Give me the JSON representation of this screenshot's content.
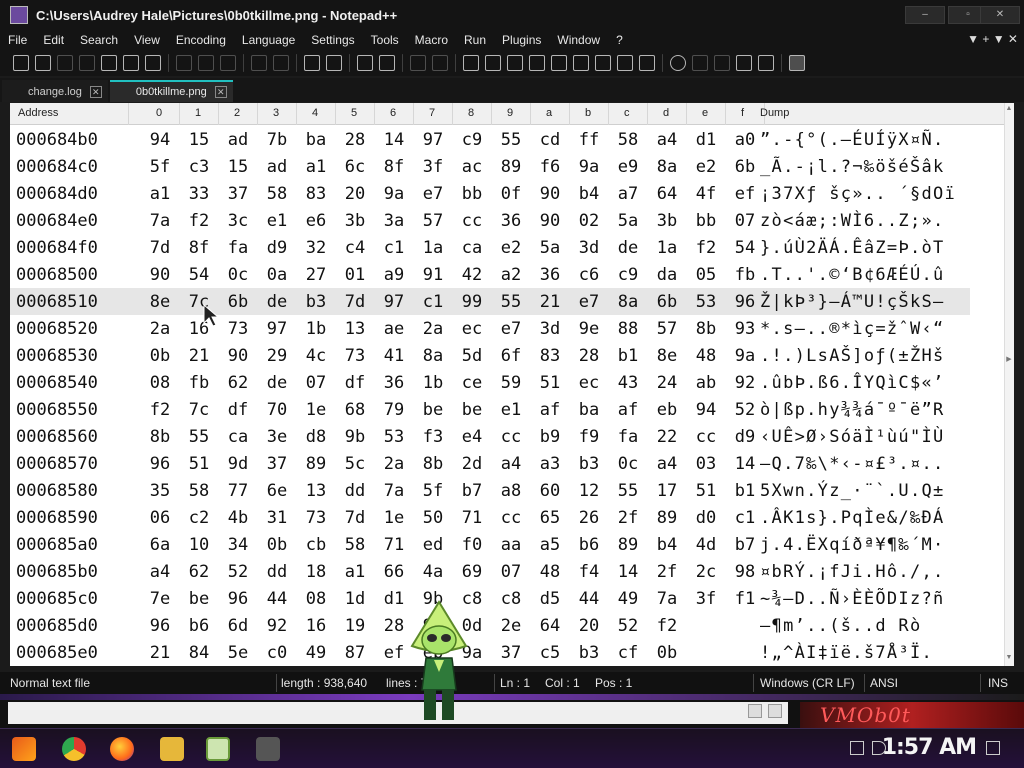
{
  "window": {
    "title": "C:\\Users\\Audrey Hale\\Pictures\\0b0tkillme.png - Notepad++"
  },
  "window_controls": {
    "minimize": "–",
    "maximize": "▫",
    "close": "✕"
  },
  "menu": {
    "items": [
      "File",
      "Edit",
      "Search",
      "View",
      "Encoding",
      "Language",
      "Settings",
      "Tools",
      "Macro",
      "Run",
      "Plugins",
      "Window",
      "?"
    ],
    "right": "▼  +  ▼  ✕"
  },
  "tabs": [
    {
      "label": "change.log",
      "active": false
    },
    {
      "label": "0b0tkillme.png",
      "active": true
    }
  ],
  "hex": {
    "header": {
      "address": "Address",
      "columns": [
        "0",
        "1",
        "2",
        "3",
        "4",
        "5",
        "6",
        "7",
        "8",
        "9",
        "a",
        "b",
        "c",
        "d",
        "e",
        "f"
      ],
      "dump": "Dump"
    },
    "rows": [
      {
        "addr": "000684b0",
        "bytes": [
          "94",
          "15",
          "ad",
          "7b",
          "ba",
          "28",
          "14",
          "97",
          "c9",
          "55",
          "cd",
          "ff",
          "58",
          "a4",
          "d1",
          "a0"
        ],
        "dump": "”.-{°(.—ÉUÍÿX¤Ñ."
      },
      {
        "addr": "000684c0",
        "bytes": [
          "5f",
          "c3",
          "15",
          "ad",
          "a1",
          "6c",
          "8f",
          "3f",
          "ac",
          "89",
          "f6",
          "9a",
          "e9",
          "8a",
          "e2",
          "6b"
        ],
        "dump": "_Ã.-¡l.?¬‰öšéŠâk"
      },
      {
        "addr": "000684d0",
        "bytes": [
          "a1",
          "33",
          "37",
          "58",
          "83",
          "20",
          "9a",
          "e7",
          "bb",
          "0f",
          "90",
          "b4",
          "a7",
          "64",
          "4f",
          "ef"
        ],
        "dump": "¡37Xƒ šç».. ´§dOï"
      },
      {
        "addr": "000684e0",
        "bytes": [
          "7a",
          "f2",
          "3c",
          "e1",
          "e6",
          "3b",
          "3a",
          "57",
          "cc",
          "36",
          "90",
          "02",
          "5a",
          "3b",
          "bb",
          "07"
        ],
        "dump": "zò<áæ;:WÌ6..Z;»."
      },
      {
        "addr": "000684f0",
        "bytes": [
          "7d",
          "8f",
          "fa",
          "d9",
          "32",
          "c4",
          "c1",
          "1a",
          "ca",
          "e2",
          "5a",
          "3d",
          "de",
          "1a",
          "f2",
          "54"
        ],
        "dump": "}.úÙ2ÄÁ.ÊâZ=Þ.òT"
      },
      {
        "addr": "00068500",
        "bytes": [
          "90",
          "54",
          "0c",
          "0a",
          "27",
          "01",
          "a9",
          "91",
          "42",
          "a2",
          "36",
          "c6",
          "c9",
          "da",
          "05",
          "fb"
        ],
        "dump": ".T..'.©‘B¢6ÆÉÚ.û"
      },
      {
        "addr": "00068510",
        "bytes": [
          "8e",
          "7c",
          "6b",
          "de",
          "b3",
          "7d",
          "97",
          "c1",
          "99",
          "55",
          "21",
          "e7",
          "8a",
          "6b",
          "53",
          "96"
        ],
        "dump": "Ž|kÞ³}—Á™U!çŠkS–"
      },
      {
        "addr": "00068520",
        "bytes": [
          "2a",
          "16",
          "73",
          "97",
          "1b",
          "13",
          "ae",
          "2a",
          "ec",
          "e7",
          "3d",
          "9e",
          "88",
          "57",
          "8b",
          "93"
        ],
        "dump": "*.s—..®*ìç=žˆW‹“"
      },
      {
        "addr": "00068530",
        "bytes": [
          "0b",
          "21",
          "90",
          "29",
          "4c",
          "73",
          "41",
          "8a",
          "5d",
          "6f",
          "83",
          "28",
          "b1",
          "8e",
          "48",
          "9a"
        ],
        "dump": ".!.)LsAŠ]oƒ(±ŽHš"
      },
      {
        "addr": "00068540",
        "bytes": [
          "08",
          "fb",
          "62",
          "de",
          "07",
          "df",
          "36",
          "1b",
          "ce",
          "59",
          "51",
          "ec",
          "43",
          "24",
          "ab",
          "92"
        ],
        "dump": ".ûbÞ.ß6.ÎYQìC$«’"
      },
      {
        "addr": "00068550",
        "bytes": [
          "f2",
          "7c",
          "df",
          "70",
          "1e",
          "68",
          "79",
          "be",
          "be",
          "e1",
          "af",
          "ba",
          "af",
          "eb",
          "94",
          "52"
        ],
        "dump": "ò|ßp.hy¾¾á¯º¯ë”R"
      },
      {
        "addr": "00068560",
        "bytes": [
          "8b",
          "55",
          "ca",
          "3e",
          "d8",
          "9b",
          "53",
          "f3",
          "e4",
          "cc",
          "b9",
          "f9",
          "fa",
          "22",
          "cc",
          "d9"
        ],
        "dump": "‹UÊ>Ø›SóäÌ¹ùú\"ÌÙ"
      },
      {
        "addr": "00068570",
        "bytes": [
          "96",
          "51",
          "9d",
          "37",
          "89",
          "5c",
          "2a",
          "8b",
          "2d",
          "a4",
          "a3",
          "b3",
          "0c",
          "a4",
          "03",
          "14"
        ],
        "dump": "–Q.7‰\\*‹-¤£³.¤.."
      },
      {
        "addr": "00068580",
        "bytes": [
          "35",
          "58",
          "77",
          "6e",
          "13",
          "dd",
          "7a",
          "5f",
          "b7",
          "a8",
          "60",
          "12",
          "55",
          "17",
          "51",
          "b1"
        ],
        "dump": "5Xwn.Ýz_·¨`.U.Q±"
      },
      {
        "addr": "00068590",
        "bytes": [
          "06",
          "c2",
          "4b",
          "31",
          "73",
          "7d",
          "1e",
          "50",
          "71",
          "cc",
          "65",
          "26",
          "2f",
          "89",
          "d0",
          "c1"
        ],
        "dump": ".ÂK1s}.PqÌe&/‰ÐÁ"
      },
      {
        "addr": "000685a0",
        "bytes": [
          "6a",
          "10",
          "34",
          "0b",
          "cb",
          "58",
          "71",
          "ed",
          "f0",
          "aa",
          "a5",
          "b6",
          "89",
          "b4",
          "4d",
          "b7"
        ],
        "dump": "j.4.ËXqíðª¥¶‰´M·"
      },
      {
        "addr": "000685b0",
        "bytes": [
          "a4",
          "62",
          "52",
          "dd",
          "18",
          "a1",
          "66",
          "4a",
          "69",
          "07",
          "48",
          "f4",
          "14",
          "2f",
          "2c",
          "98"
        ],
        "dump": "¤bRÝ.¡fJi.Hô./,."
      },
      {
        "addr": "000685c0",
        "bytes": [
          "7e",
          "be",
          "96",
          "44",
          "08",
          "1d",
          "d1",
          "9b",
          "c8",
          "c8",
          "d5",
          "44",
          "49",
          "7a",
          "3f",
          "f1"
        ],
        "dump": "~¾–D..Ñ›ÈÈÕDIz?ñ"
      },
      {
        "addr": "000685d0",
        "bytes": [
          "96",
          "b6",
          "6d",
          "92",
          "16",
          "19",
          "28",
          "9a",
          "0d",
          "2e",
          "64",
          "20",
          "52",
          "f2"
        ],
        "dump": "–¶m’..(š..d Rò"
      },
      {
        "addr": "000685e0",
        "bytes": [
          "21",
          "84",
          "5e",
          "c0",
          "49",
          "87",
          "ef",
          "eb",
          "9a",
          "37",
          "c5",
          "b3",
          "cf",
          "0b"
        ],
        "dump": "!„^ÀI‡ïë.š7Å³Ï."
      }
    ]
  },
  "status": {
    "file_type": "Normal text file",
    "length": "length : 938,640",
    "lines": "lines : 7",
    "ln": "Ln : 1",
    "col": "Col : 1",
    "pos": "Pos : 1",
    "eol": "Windows (CR LF)",
    "encoding": "ANSI",
    "mode": "INS"
  },
  "banner": {
    "text": "VMOb0t"
  },
  "taskbar": {
    "clock": "1:57 AM"
  },
  "colors": {
    "accent": "#21c0c0",
    "background": "#1b1b1b",
    "banner": "#b02020",
    "taskbar": "#24103a"
  }
}
